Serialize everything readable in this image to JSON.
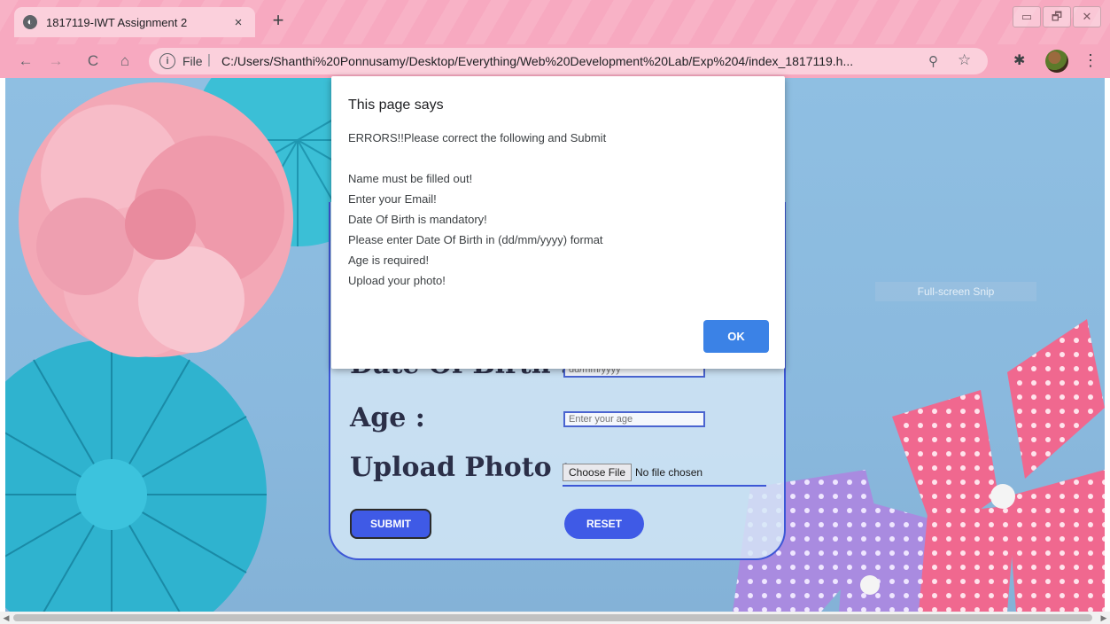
{
  "browser": {
    "tab_title": "1817119-IWT Assignment 2",
    "tab_close": "×",
    "new_tab": "+",
    "window_controls": [
      "▭",
      "🗗",
      "✕"
    ],
    "nav": {
      "back": "←",
      "forward": "→",
      "reload": "C",
      "home": "⌂"
    },
    "address": {
      "info": "i",
      "scheme": "File",
      "separator": "|",
      "url": "C:/Users/Shanthi%20Ponnusamy/Desktop/Everything/Web%20Development%20Lab/Exp%204/index_1817119.h...",
      "zoom": "⚲",
      "star": "☆"
    },
    "extensions": "✱",
    "menu": "⋮"
  },
  "form": {
    "dob_label": "Date Of Birth :",
    "dob_placeholder": "dd/mm/yyyy",
    "age_label": "Age :",
    "age_placeholder": "Enter your age",
    "photo_label": "Upload Photo :",
    "file_button": "Choose File",
    "file_status": "No file chosen",
    "submit": "SUBMIT",
    "reset": "RESET"
  },
  "snip_label": "Full-screen Snip",
  "dialog": {
    "title": "This page says",
    "lines": [
      "ERRORS!!Please correct the following and Submit",
      "",
      "Name must be filled out!",
      "Enter your Email!",
      "Date Of Birth is mandatory!",
      "Please enter Date Of Birth in (dd/mm/yyyy) format",
      "Age is required!",
      "Upload your photo!"
    ],
    "ok": "OK"
  },
  "scrollbar": {
    "left": "◀",
    "right": "▶"
  }
}
